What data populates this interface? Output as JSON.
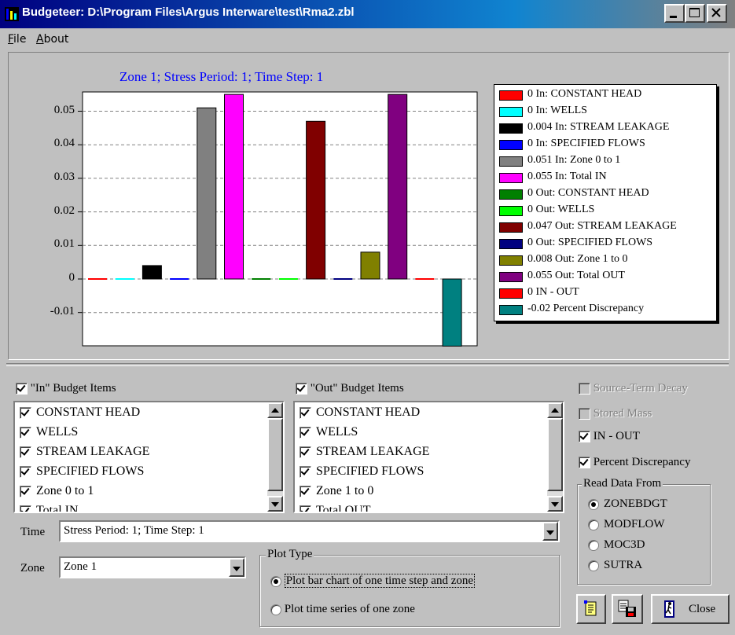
{
  "window": {
    "title": "Budgeteer: D:\\Program Files\\Argus Interware\\test\\Rma2.zbl"
  },
  "menu": [
    {
      "label": "File",
      "accel": "F",
      "rest": "ile"
    },
    {
      "label": "About",
      "accel": "A",
      "rest": "bout"
    }
  ],
  "chart_data": {
    "type": "bar",
    "title": "Zone  1; Stress Period: 1; Time Step: 1",
    "ylim": [
      -0.02,
      0.055
    ],
    "yticks": [
      "0.05",
      "0.04",
      "0.03",
      "0.02",
      "0.01",
      "0",
      "-0.01"
    ],
    "grid": true,
    "legend_position": "right",
    "series": [
      {
        "name": "In: CONSTANT HEAD",
        "value": 0,
        "label": "0",
        "color": "#ff0000"
      },
      {
        "name": "In: WELLS",
        "value": 0,
        "label": "0",
        "color": "#00ffff"
      },
      {
        "name": "In: STREAM LEAKAGE",
        "value": 0.004,
        "label": "0.004",
        "color": "#000000"
      },
      {
        "name": "In: SPECIFIED FLOWS",
        "value": 0,
        "label": "0",
        "color": "#0000ff"
      },
      {
        "name": "In: Zone  0 to  1",
        "value": 0.051,
        "label": "0.051",
        "color": "#808080"
      },
      {
        "name": "In: Total IN",
        "value": 0.055,
        "label": "0.055",
        "color": "#ff00ff"
      },
      {
        "name": "Out: CONSTANT HEAD",
        "value": 0,
        "label": "0",
        "color": "#008000"
      },
      {
        "name": "Out: WELLS",
        "value": 0,
        "label": "0",
        "color": "#00ff00"
      },
      {
        "name": "Out: STREAM LEAKAGE",
        "value": 0.047,
        "label": "0.047",
        "color": "#800000"
      },
      {
        "name": "Out: SPECIFIED FLOWS",
        "value": 0,
        "label": "0",
        "color": "#000080"
      },
      {
        "name": "Out: Zone  1 to  0",
        "value": 0.008,
        "label": "0.008",
        "color": "#808000"
      },
      {
        "name": "Out: Total OUT",
        "value": 0.055,
        "label": "0.055",
        "color": "#800080"
      },
      {
        "name": "IN - OUT",
        "value": 0,
        "label": "0",
        "color": "#ff0000"
      },
      {
        "name": "Percent Discrepancy",
        "value": -0.02,
        "label": "-0.02",
        "color": "#008080"
      }
    ]
  },
  "in_budget": {
    "header": "\"In\" Budget Items",
    "checked": true,
    "items": [
      {
        "label": "CONSTANT HEAD",
        "checked": true
      },
      {
        "label": "WELLS",
        "checked": true
      },
      {
        "label": "STREAM LEAKAGE",
        "checked": true
      },
      {
        "label": "SPECIFIED FLOWS",
        "checked": true
      },
      {
        "label": "Zone  0 to  1",
        "checked": true
      },
      {
        "label": "Total IN",
        "checked": true
      }
    ]
  },
  "out_budget": {
    "header": "\"Out\" Budget Items",
    "checked": true,
    "items": [
      {
        "label": "CONSTANT HEAD",
        "checked": true
      },
      {
        "label": "WELLS",
        "checked": true
      },
      {
        "label": "STREAM LEAKAGE",
        "checked": true
      },
      {
        "label": "SPECIFIED FLOWS",
        "checked": true
      },
      {
        "label": "Zone  1 to  0",
        "checked": true
      },
      {
        "label": "Total OUT",
        "checked": true
      }
    ]
  },
  "options": {
    "source_term_decay": {
      "label": "Source-Term Decay",
      "checked": false,
      "enabled": false
    },
    "stored_mass": {
      "label": "Stored Mass",
      "checked": false,
      "enabled": false
    },
    "in_out": {
      "label": "IN - OUT",
      "checked": true
    },
    "percent_discrepancy": {
      "label": "Percent Discrepancy",
      "checked": true
    }
  },
  "read_data_from": {
    "title": "Read Data From",
    "options": [
      "ZONEBDGT",
      "MODFLOW",
      "MOC3D",
      "SUTRA"
    ],
    "selected": "ZONEBDGT"
  },
  "time": {
    "label": "Time",
    "value": "Stress Period: 1; Time Step: 1"
  },
  "zone": {
    "label": "Zone",
    "value": "Zone  1"
  },
  "plot_type": {
    "title": "Plot Type",
    "options": [
      "Plot bar chart of one time step and zone",
      "Plot time series of one zone"
    ],
    "selected": 0
  },
  "buttons": {
    "close": "Close"
  }
}
